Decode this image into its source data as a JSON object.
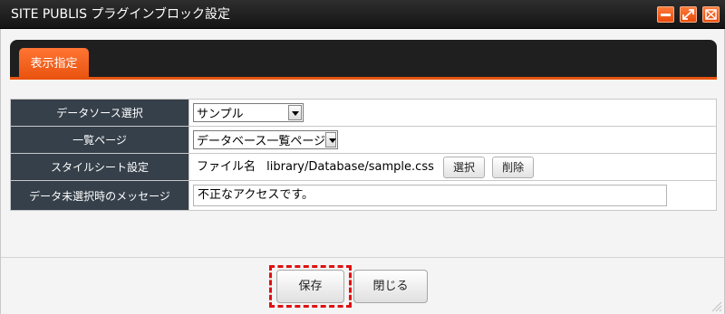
{
  "window": {
    "title": "SITE PUBLIS プラグインブロック設定",
    "accent": "#e9520e"
  },
  "tabs": [
    {
      "label": "表示指定",
      "active": true
    }
  ],
  "form": {
    "data_source": {
      "label": "データソース選択",
      "selected": "サンプル"
    },
    "list_page": {
      "label": "一覧ページ",
      "selected": "データベース一覧ページ"
    },
    "stylesheet": {
      "label": "スタイルシート設定",
      "file_label": "ファイル名",
      "file_path": "library/Database/sample.css",
      "select_button": "選択",
      "delete_button": "削除"
    },
    "no_data_message": {
      "label": "データ未選択時のメッセージ",
      "value": "不正なアクセスです。"
    }
  },
  "footer": {
    "save_button": "保存",
    "close_button": "閉じる"
  }
}
